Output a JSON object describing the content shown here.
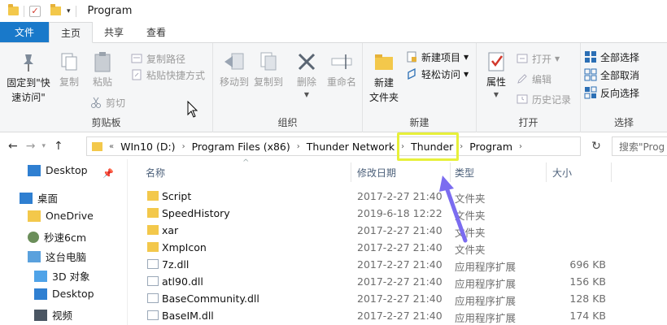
{
  "window": {
    "title": "Program"
  },
  "tabs": {
    "file": "文件",
    "home": "主页",
    "share": "共享",
    "view": "查看"
  },
  "ribbon": {
    "clipboard": {
      "label": "剪贴板",
      "pin_quick": "固定到\"快\n速访问\"",
      "copy": "复制",
      "paste": "粘贴",
      "copy_path": "复制路径",
      "paste_shortcut": "粘贴快捷方式",
      "cut": "剪切"
    },
    "organize": {
      "label": "组织",
      "move_to": "移动到",
      "copy_to": "复制到",
      "delete": "删除",
      "rename": "重命名"
    },
    "new": {
      "label": "新建",
      "new_folder": "新建\n文件夹",
      "new_item": "新建项目",
      "easy_access": "轻松访问"
    },
    "open": {
      "label": "打开",
      "properties": "属性",
      "open": "打开",
      "edit": "编辑",
      "history": "历史记录"
    },
    "select": {
      "label": "选择",
      "select_all": "全部选择",
      "select_none": "全部取消",
      "invert": "反向选择"
    }
  },
  "address": {
    "crumbs": [
      "WIn10 (D:)",
      "Program Files (x86)",
      "Thunder Network",
      "Thunder",
      "Program"
    ],
    "search_placeholder": "搜索\"Prog"
  },
  "navpane": {
    "items": [
      "Desktop",
      "桌面",
      "OneDrive",
      "秒速6cm",
      "这台电脑",
      "3D 对象",
      "Desktop",
      "视频"
    ]
  },
  "columns": {
    "name": "名称",
    "date": "修改日期",
    "type": "类型",
    "size": "大小"
  },
  "files": [
    {
      "name": "Script",
      "date": "2017-2-27 21:40",
      "type": "文件夹",
      "size": "",
      "kind": "folder"
    },
    {
      "name": "SpeedHistory",
      "date": "2019-6-18 12:22",
      "type": "文件夹",
      "size": "",
      "kind": "folder"
    },
    {
      "name": "xar",
      "date": "2017-2-27 21:40",
      "type": "文件夹",
      "size": "",
      "kind": "folder"
    },
    {
      "name": "XmpIcon",
      "date": "2017-2-27 21:40",
      "type": "文件夹",
      "size": "",
      "kind": "folder"
    },
    {
      "name": "7z.dll",
      "date": "2017-2-27 21:40",
      "type": "应用程序扩展",
      "size": "696 KB",
      "kind": "dll"
    },
    {
      "name": "atl90.dll",
      "date": "2017-2-27 21:40",
      "type": "应用程序扩展",
      "size": "156 KB",
      "kind": "dll"
    },
    {
      "name": "BaseCommunity.dll",
      "date": "2017-2-27 21:40",
      "type": "应用程序扩展",
      "size": "128 KB",
      "kind": "dll"
    },
    {
      "name": "BaseIM.dll",
      "date": "2017-2-27 21:40",
      "type": "应用程序扩展",
      "size": "174 KB",
      "kind": "dll"
    }
  ],
  "colors": {
    "file_tab": "#1979ca",
    "highlight": "#e7f03a",
    "arrow": "#7b6cf0"
  }
}
